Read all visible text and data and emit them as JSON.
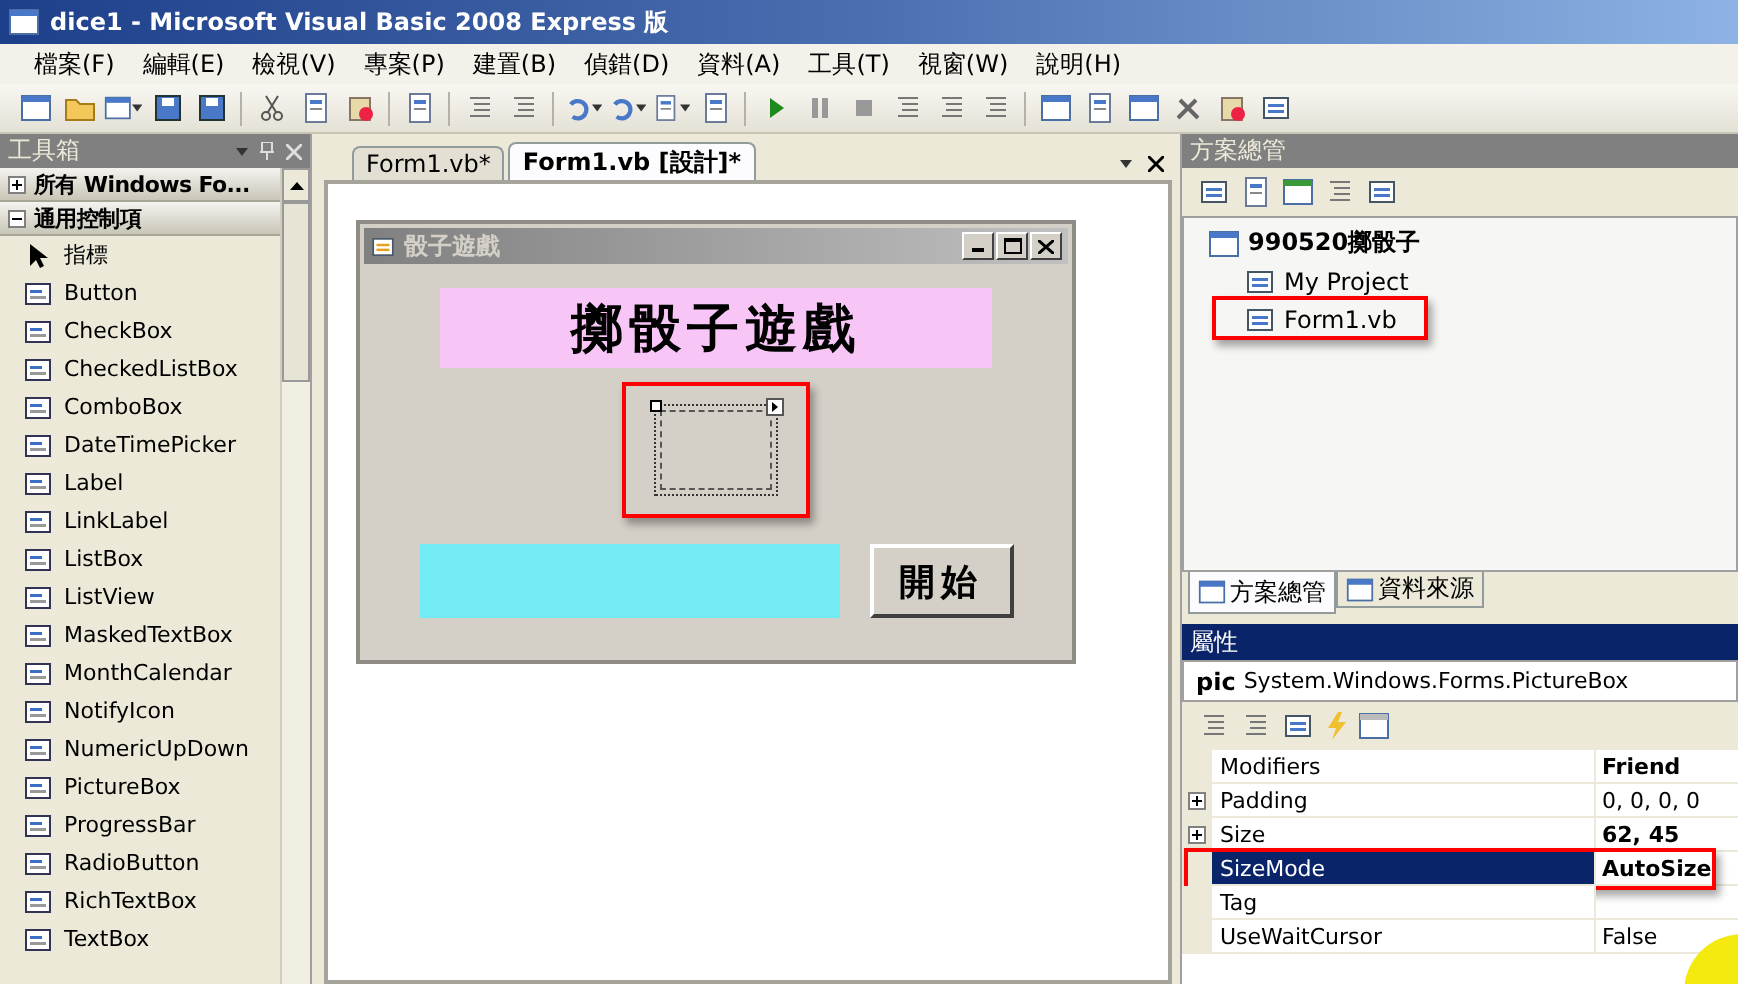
{
  "window": {
    "title": "dice1 - Microsoft Visual Basic 2008 Express 版"
  },
  "menu": [
    "檔案(F)",
    "編輯(E)",
    "檢視(V)",
    "專案(P)",
    "建置(B)",
    "偵錯(D)",
    "資料(A)",
    "工具(T)",
    "視窗(W)",
    "說明(H)"
  ],
  "toolbox": {
    "title": "工具箱",
    "groups": [
      {
        "label": "所有 Windows Fo...",
        "expanded": false
      },
      {
        "label": "通用控制項",
        "expanded": true
      }
    ],
    "items": [
      "指標",
      "Button",
      "CheckBox",
      "CheckedListBox",
      "ComboBox",
      "DateTimePicker",
      "Label",
      "LinkLabel",
      "ListBox",
      "ListView",
      "MaskedTextBox",
      "MonthCalendar",
      "NotifyIcon",
      "NumericUpDown",
      "PictureBox",
      "ProgressBar",
      "RadioButton",
      "RichTextBox",
      "TextBox"
    ]
  },
  "editor": {
    "tabs": [
      {
        "label": "Form1.vb*",
        "selected": false
      },
      {
        "label": "Form1.vb [設計]*",
        "selected": true
      }
    ],
    "form": {
      "title": "骰子遊戲",
      "heading": "擲骰子遊戲",
      "picture_box": {
        "selected": true,
        "highlighted": true
      },
      "button": "開始"
    }
  },
  "solution_explorer": {
    "title": "方案總管",
    "tree": [
      {
        "label": "990520擲骰子",
        "children": [
          {
            "label": "My Project",
            "highlighted": false
          },
          {
            "label": "Form1.vb",
            "highlighted": true
          }
        ]
      }
    ],
    "tabs": [
      {
        "label": "方案總管",
        "selected": true
      },
      {
        "label": "資料來源",
        "selected": false
      }
    ]
  },
  "properties": {
    "title": "屬性",
    "object_name": "pic",
    "object_type": "System.Windows.Forms.PictureBox",
    "rows": [
      {
        "name": "Modifiers",
        "value": "Friend",
        "expandable": false,
        "modified": true,
        "selected": false,
        "highlighted": false
      },
      {
        "name": "Padding",
        "value": "0, 0, 0, 0",
        "expandable": true,
        "modified": false,
        "selected": false,
        "highlighted": false
      },
      {
        "name": "Size",
        "value": "62, 45",
        "expandable": true,
        "modified": true,
        "selected": false,
        "highlighted": false
      },
      {
        "name": "SizeMode",
        "value": "AutoSize",
        "expandable": false,
        "modified": true,
        "selected": true,
        "highlighted": true
      },
      {
        "name": "Tag",
        "expandable": false,
        "selected": false,
        "highlighted": false
      },
      {
        "name": "UseWaitCursor",
        "value": "False",
        "expandable": false,
        "modified": false,
        "selected": false,
        "highlighted": false
      }
    ]
  }
}
